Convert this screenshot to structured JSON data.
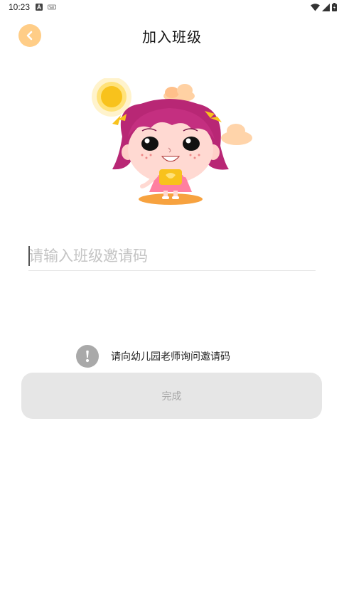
{
  "status_bar": {
    "time": "10:23"
  },
  "header": {
    "title": "加入班级"
  },
  "form": {
    "invite_code_value": "",
    "invite_code_placeholder": "请输入班级邀请码"
  },
  "hint": {
    "text": "请向幼儿园老师询问邀请码"
  },
  "actions": {
    "done_label": "完成"
  },
  "colors": {
    "accent": "#ffcd87",
    "button_bg": "#e6e6e6",
    "button_text": "#a8a8a8",
    "hint_icon": "#a9a9a9"
  },
  "icons": {
    "back": "chevron-left-icon",
    "hint": "exclamation-icon",
    "status": [
      "a-badge-icon",
      "keyboard-icon",
      "wifi-icon",
      "signal-icon",
      "battery-icon"
    ]
  }
}
